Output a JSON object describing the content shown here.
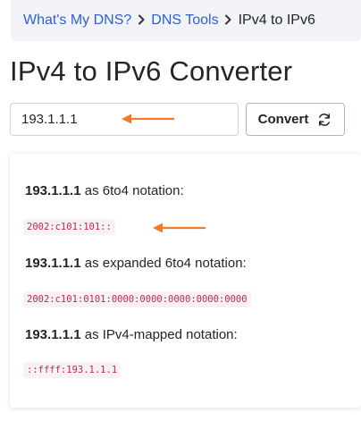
{
  "breadcrumb": {
    "items": [
      "What's My DNS?",
      "DNS Tools"
    ],
    "current": "IPv4 to IPv6"
  },
  "page": {
    "title": "IPv4 to IPv6 Converter"
  },
  "form": {
    "ip_value": "193.1.1.1",
    "convert_label": "Convert",
    "convert_icon": "refresh-icon"
  },
  "results": [
    {
      "ip": "193.1.1.1",
      "description": " as 6to4 notation:",
      "code": "2002:c101:101::"
    },
    {
      "ip": "193.1.1.1",
      "description": " as expanded 6to4 notation:",
      "code": "2002:c101:0101:0000:0000:0000:0000:0000"
    },
    {
      "ip": "193.1.1.1",
      "description": " as IPv4-mapped notation:",
      "code": "::ffff:193.1.1.1"
    }
  ],
  "colors": {
    "link": "#2f5fd0",
    "annotation_arrow": "#f07c2b",
    "code_text": "#c7254e",
    "code_bg": "#f9f2f4",
    "breadcrumb_bg": "#f1f3f6"
  }
}
